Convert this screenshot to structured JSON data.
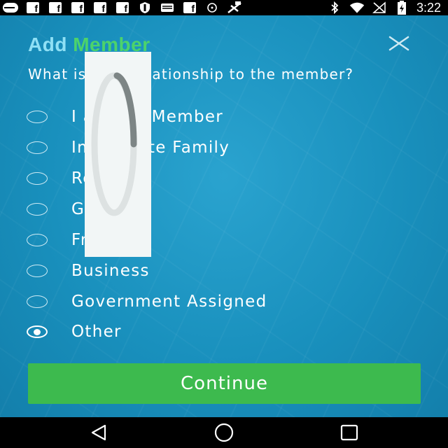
{
  "status_bar": {
    "time": "3:22",
    "left_icons": [
      "message-icon",
      "facebook-icon",
      "facebook-icon",
      "facebook-icon",
      "facebook-icon",
      "facebook-icon",
      "shield-icon",
      "mail-icon",
      "facebook-icon",
      "sync-icon",
      "no-signal-icon"
    ],
    "right_icons": [
      "bluetooth-icon",
      "wifi-icon",
      "signal-icon",
      "battery-icon"
    ],
    "fb_letter": "f"
  },
  "dialog": {
    "title_add": "Add",
    "title_member": "Member",
    "question": "What is your relationship to the member?",
    "options": [
      {
        "label": "I am the Member",
        "checked": false
      },
      {
        "label": "Immediate Family",
        "checked": false
      },
      {
        "label": "Relative",
        "checked": false
      },
      {
        "label": "Guardian",
        "checked": false
      },
      {
        "label": "Friend",
        "checked": false
      },
      {
        "label": "Business",
        "checked": false
      },
      {
        "label": "Government Assigned",
        "checked": false
      },
      {
        "label": "Other",
        "checked": true
      }
    ],
    "continue_label": "Continue"
  },
  "colors": {
    "title_add": "#8fe0f5",
    "title_member": "#4cd36b",
    "continue_bg": "#3dba4e",
    "background": "#1990bd"
  }
}
